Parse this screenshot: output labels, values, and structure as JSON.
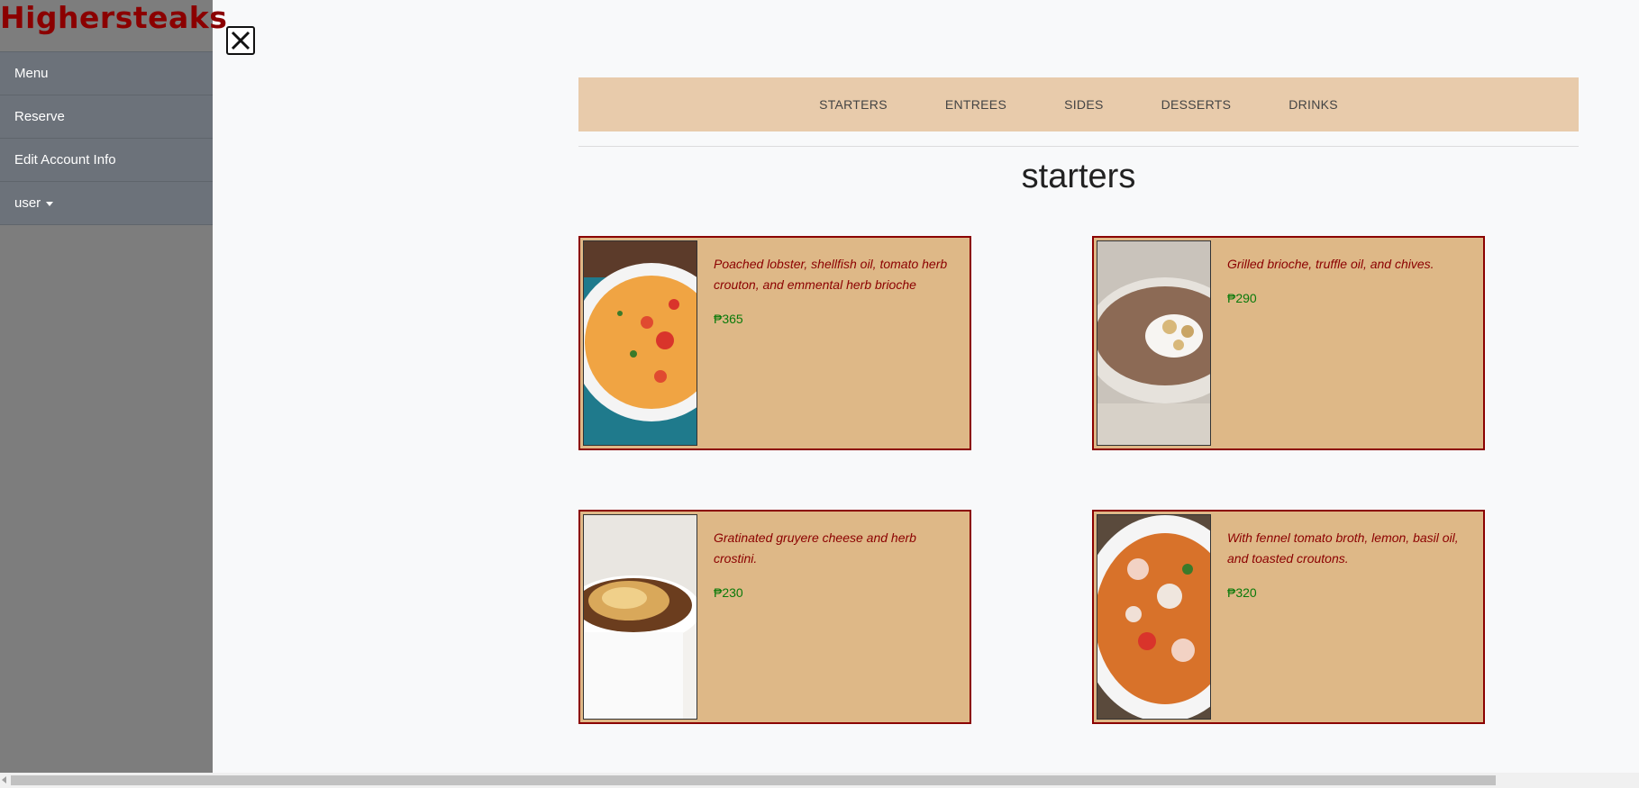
{
  "sidebar": {
    "brand": "Highersteaks",
    "items": [
      {
        "label": "Menu"
      },
      {
        "label": "Reserve"
      },
      {
        "label": "Edit Account Info"
      },
      {
        "label": "user"
      }
    ]
  },
  "categories": [
    "STARTERS",
    "ENTREES",
    "SIDES",
    "DESSERTS",
    "DRINKS"
  ],
  "section_title": "starters",
  "items": [
    {
      "description": "Poached lobster, shellfish oil, tomato herb crouton, and emmental herb brioche",
      "price": "₱365",
      "image": "lobster-bisque-image"
    },
    {
      "description": "Grilled brioche, truffle oil, and chives.",
      "price": "₱290",
      "image": "mushroom-soup-image"
    },
    {
      "description": "Gratinated gruyere cheese and herb crostini.",
      "price": "₱230",
      "image": "onion-soup-image"
    },
    {
      "description": "With fennel tomato broth, lemon, basil oil, and toasted croutons.",
      "price": "₱320",
      "image": "seafood-stew-image"
    }
  ],
  "colors": {
    "brand": "#8b0000",
    "card_bg": "#deb887",
    "price": "#0a7a0a",
    "catbar_bg": "#e8cbab"
  },
  "icons": {
    "close": "close-icon",
    "caret": "caret-down-icon"
  }
}
